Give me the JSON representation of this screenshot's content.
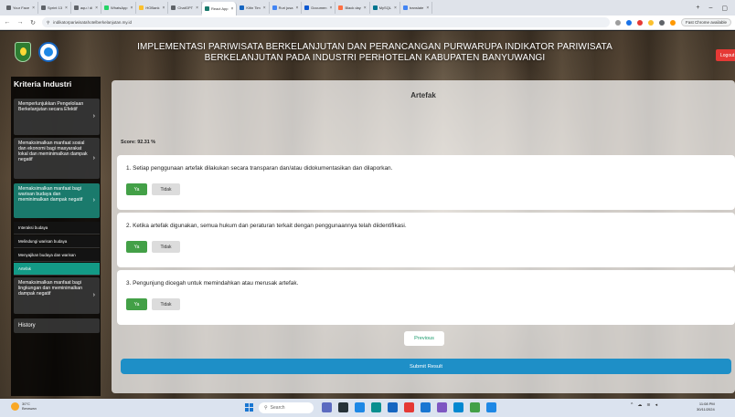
{
  "browser": {
    "tabs": [
      {
        "label": "Your Face"
      },
      {
        "label": "Sprint 13"
      },
      {
        "label": "aqu / di"
      },
      {
        "label": "WhatsApp"
      },
      {
        "label": "HOBank"
      },
      {
        "label": "ChatGPT"
      },
      {
        "label": "React App",
        "active": true
      },
      {
        "label": "Kitin Tim"
      },
      {
        "label": "Ruri jusa"
      },
      {
        "label": "Documen"
      },
      {
        "label": "Black day"
      },
      {
        "label": "MySQL"
      },
      {
        "label": "translate"
      }
    ],
    "url": "indikatorpariwisatahotelberkelanjutan.my.id",
    "chrome_button": "Fast Chrome available"
  },
  "header": {
    "title_line1": "IMPLEMENTASI PARIWISATA BERKELANJUTAN DAN PERANCANGAN PURWARUPA INDIKATOR PARIWISATA",
    "title_line2": "BERKELANJUTAN PADA INDUSTRI PERHOTELAN KABUPATEN BANYUWANGI",
    "logout_label": "Logout"
  },
  "sidebar": {
    "title": "Kriteria Industri",
    "items": [
      {
        "label": "Memperlunjukkan Pengelolaan Berkelanjutan secara Efektif",
        "expandable": true
      },
      {
        "label": "Memaksimalkan manfaat sosial dan ekonomi bagi masyarakat lokal dan meminimalkan dampak negatif",
        "expandable": true
      },
      {
        "label": "Memaksimalkan manfaat bagi warisan budaya dan meminimalkan dampak negatif",
        "expandable": true,
        "active": true
      },
      {
        "label": "Memaksimalkan manfaat bagi lingkungan dan meminimalkan dampak negatif",
        "expandable": true
      }
    ],
    "subitems": [
      {
        "label": "Interaksi budaya"
      },
      {
        "label": "Melindungi warisan budaya"
      },
      {
        "label": "Menyajikan budaya dan warisan"
      },
      {
        "label": "Artefak",
        "selected": true
      }
    ],
    "history_label": "History"
  },
  "main": {
    "title": "Artefak",
    "score_text": "Score: 92.31 %",
    "questions": [
      {
        "text": "1. Setiap penggunaan artefak dilakukan secara transparan dan/atau didokumentasikan dan dilaporkan.",
        "yes": "Ya",
        "no": "Tidak"
      },
      {
        "text": "2. Ketika artefak digunakan, semua hukum dan peraturan terkait dengan penggunaannya telah diidentifikasi.",
        "yes": "Ya",
        "no": "Tidak"
      },
      {
        "text": "3. Pengunjung dicegah untuk memindahkan atau merusak artefak.",
        "yes": "Ya",
        "no": "Tidak"
      }
    ],
    "previous_label": "Previous",
    "submit_label": "Submit Result"
  },
  "taskbar": {
    "weather_temp": "30°C",
    "weather_desc": "Berawan",
    "search_placeholder": "Search",
    "time": "11:08 PM",
    "date": "30/11/2024"
  },
  "colors": {
    "accent_green": "#43a047",
    "submit_blue": "#1e8fc7",
    "sidebar_active": "#1a7a6c",
    "logout_red": "#e53935"
  }
}
